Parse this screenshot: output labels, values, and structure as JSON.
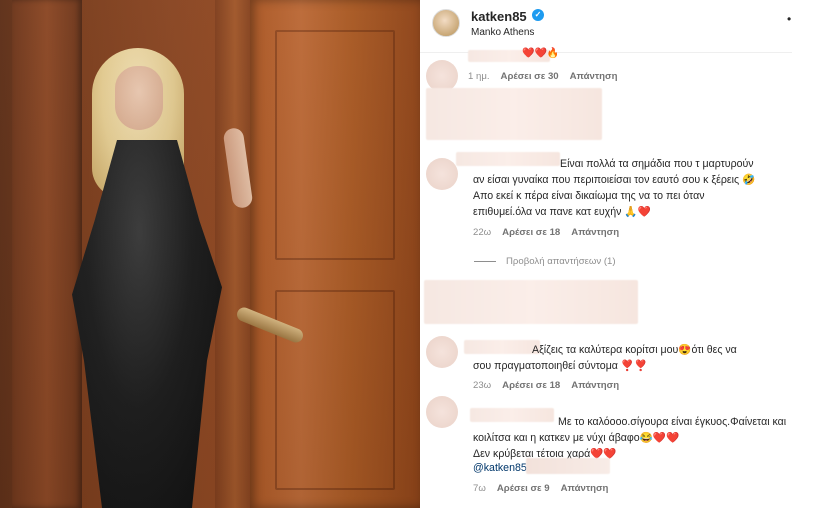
{
  "profile": {
    "username": "katken85",
    "location": "Manko Athens",
    "verified": true,
    "more": "•"
  },
  "comments": [
    {
      "id": "c0",
      "text_tail": "❤️❤️🔥",
      "time": "1 ημ.",
      "likes": "Αρέσει σε 30",
      "reply": "Απάντηση"
    },
    {
      "id": "c1",
      "line1": "Είναι πολλά τα σημάδια που τ μαρτυρούν",
      "line2": "αν είσαι γυναίκα που περιποιείσαι τον εαυτό σου κ ξέρεις 🤣",
      "line3": "Απο εκεί κ πέρα είναι δικαίωμα της να το πει όταν",
      "line4": "επιθυμεί.όλα να πανε κατ ευχήν 🙏❤️",
      "time": "22ω",
      "likes": "Αρέσει σε 18",
      "reply": "Απάντηση",
      "view_replies": "Προβολή απαντήσεων (1)"
    },
    {
      "id": "c2",
      "line1": "Αξίζεις τα καλύτερα κορίτσι μου😍ότι θες να",
      "line2": "σου πραγματοποιηθεί σύντομα ❣️❣️",
      "time": "23ω",
      "likes": "Αρέσει σε 18",
      "reply": "Απάντηση"
    },
    {
      "id": "c3",
      "line1": "Με το καλόοοο.σίγουρα είναι έγκυος.Φαίνεται και",
      "line2": "κοιλίτσα και η κατκεν με νύχι άβαφο😂❤️❤️",
      "line3": "Δεν κρύβεται τέτοια χαρά❤️❤️",
      "mention": "@katken85",
      "time": "7ω",
      "likes": "Αρέσει σε 9",
      "reply": "Απάντηση"
    }
  ],
  "colors": {
    "accent": "#1d9bf0",
    "text": "#262626",
    "muted": "#8e8e8e",
    "mention": "#00376b"
  }
}
